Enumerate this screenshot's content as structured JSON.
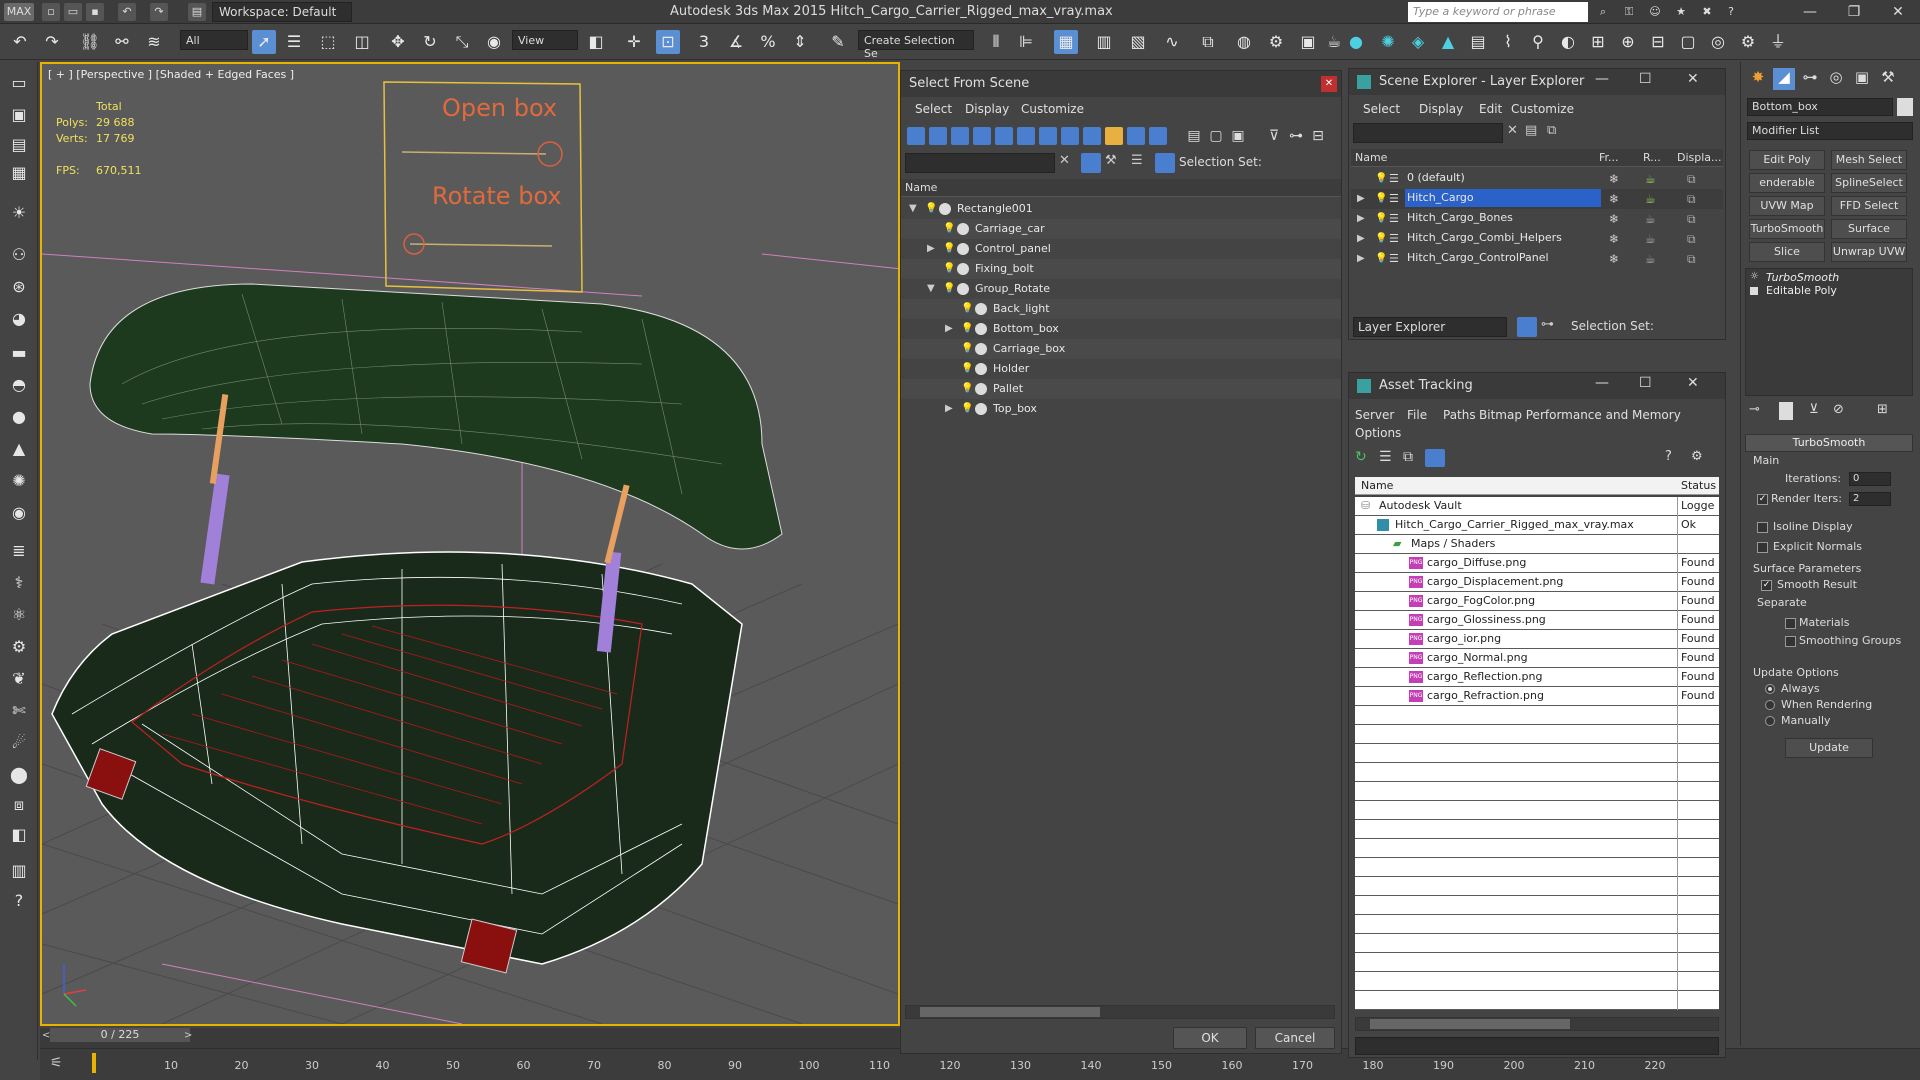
{
  "app": {
    "title": "Autodesk 3ds Max  2015      Hitch_Cargo_Carrier_Rigged_max_vray.max",
    "workspace": "Workspace: Default",
    "search_placeholder": "Type a keyword or phrase",
    "window_controls": [
      "—",
      "❐",
      "✕"
    ]
  },
  "toolbar": {
    "filter_value": "All",
    "view_value": "View",
    "create_selection_set": "Create Selection Se"
  },
  "viewport": {
    "label": "[ + ] [Perspective ] [Shaded + Edged Faces ]",
    "stats": {
      "total_label": "Total",
      "polys_label": "Polys:",
      "polys_value": "29 688",
      "verts_label": "Verts:",
      "verts_value": "17 769",
      "fps_label": "FPS:",
      "fps_value": "670,511"
    },
    "control_panel_text": {
      "open": "Open box",
      "rotate": "Rotate box"
    }
  },
  "timeline": {
    "slider": "0 / 225",
    "ticks": [
      "10",
      "20",
      "30",
      "40",
      "50",
      "60",
      "70",
      "80",
      "90",
      "100",
      "110",
      "120",
      "130",
      "140",
      "150",
      "160",
      "170",
      "180",
      "190",
      "200",
      "210",
      "220"
    ]
  },
  "select_from_scene": {
    "title": "Select From Scene",
    "menu": [
      "Select",
      "Display",
      "Customize"
    ],
    "selection_set_label": "Selection Set:",
    "column_name": "Name",
    "tree": [
      {
        "label": "Rectangle001",
        "level": 0,
        "expand": "open"
      },
      {
        "label": "Carriage_car",
        "level": 1,
        "expand": "none"
      },
      {
        "label": "Control_panel",
        "level": 1,
        "expand": "closed"
      },
      {
        "label": "Fixing_bolt",
        "level": 1,
        "expand": "none"
      },
      {
        "label": "Group_Rotate",
        "level": 1,
        "expand": "open"
      },
      {
        "label": "Back_light",
        "level": 2,
        "expand": "none"
      },
      {
        "label": "Bottom_box",
        "level": 2,
        "expand": "closed"
      },
      {
        "label": "Carriage_box",
        "level": 2,
        "expand": "none"
      },
      {
        "label": "Holder",
        "level": 2,
        "expand": "none"
      },
      {
        "label": "Pallet",
        "level": 2,
        "expand": "none"
      },
      {
        "label": "Top_box",
        "level": 2,
        "expand": "closed"
      }
    ],
    "ok": "OK",
    "cancel": "Cancel"
  },
  "scene_explorer": {
    "title": "Scene Explorer - Layer Explorer",
    "menu": [
      "Select",
      "Display",
      "Edit",
      "Customize"
    ],
    "columns": [
      "Name",
      "Fr...",
      "R...",
      "Displa..."
    ],
    "rows": [
      "0 (default)",
      "Hitch_Cargo",
      "Hitch_Cargo_Bones",
      "Hitch_Cargo_Combi_Helpers",
      "Hitch_Cargo_ControlPanel"
    ],
    "selected": "Hitch_Cargo",
    "footer_dropdown": "Layer Explorer",
    "selection_set_label": "Selection Set:"
  },
  "asset_tracking": {
    "title": "Asset Tracking",
    "menu": [
      "Server",
      "File",
      "Paths",
      "Bitmap Performance and Memory",
      "Options"
    ],
    "columns": [
      "Name",
      "Status"
    ],
    "rows": [
      {
        "name": "Autodesk Vault",
        "status": "Logge",
        "indent": 0,
        "icon": "vault"
      },
      {
        "name": "Hitch_Cargo_Carrier_Rigged_max_vray.max",
        "status": "Ok",
        "indent": 1,
        "icon": "max"
      },
      {
        "name": "Maps / Shaders",
        "status": "",
        "indent": 2,
        "icon": "folder"
      },
      {
        "name": "cargo_Diffuse.png",
        "status": "Found",
        "indent": 3,
        "icon": "png"
      },
      {
        "name": "cargo_Displacement.png",
        "status": "Found",
        "indent": 3,
        "icon": "png"
      },
      {
        "name": "cargo_FogColor.png",
        "status": "Found",
        "indent": 3,
        "icon": "png"
      },
      {
        "name": "cargo_Glossiness.png",
        "status": "Found",
        "indent": 3,
        "icon": "png"
      },
      {
        "name": "cargo_ior.png",
        "status": "Found",
        "indent": 3,
        "icon": "png"
      },
      {
        "name": "cargo_Normal.png",
        "status": "Found",
        "indent": 3,
        "icon": "png"
      },
      {
        "name": "cargo_Reflection.png",
        "status": "Found",
        "indent": 3,
        "icon": "png"
      },
      {
        "name": "cargo_Refraction.png",
        "status": "Found",
        "indent": 3,
        "icon": "png"
      }
    ]
  },
  "command_panel": {
    "object_name": "Bottom_box",
    "modifier_list": "Modifier List",
    "buttons": [
      "Edit Poly",
      "Mesh Select",
      "enderable Splir",
      "SplineSelect",
      "UVW Map",
      "FFD Select",
      "TurboSmooth",
      "Surface Select",
      "Slice",
      "Unwrap UVW"
    ],
    "stack": [
      "TurboSmooth",
      "Editable Poly"
    ],
    "rollout_title": "TurboSmooth",
    "main_label": "Main",
    "iterations_label": "Iterations:",
    "iterations_value": "0",
    "render_iters_label": "Render Iters:",
    "render_iters_value": "2",
    "isoline_label": "Isoline Display",
    "explicit_normals_label": "Explicit Normals",
    "surface_params_label": "Surface Parameters",
    "smooth_result_label": "Smooth Result",
    "separate_label": "Separate",
    "materials_label": "Materials",
    "smoothing_groups_label": "Smoothing Groups",
    "update_options_label": "Update Options",
    "always_label": "Always",
    "when_rendering_label": "When Rendering",
    "manually_label": "Manually",
    "update_button": "Update"
  },
  "colors": {
    "accent": "#5b8fd4",
    "viewport_border": "#e8b200",
    "selection": "#2a62c9",
    "found_text": "#222222"
  }
}
